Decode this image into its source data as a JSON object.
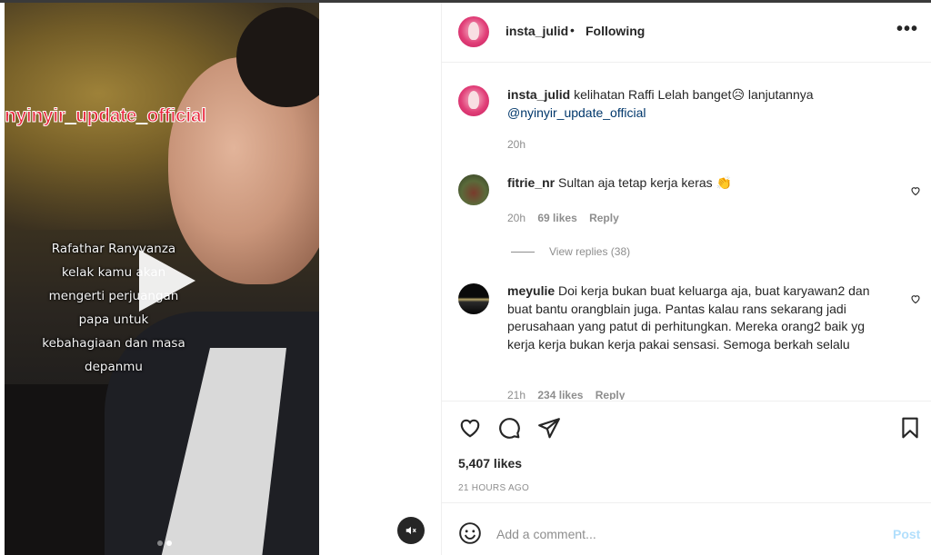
{
  "media": {
    "overlay_tag": "nyinyir_update_official",
    "caption_lines": [
      "Rafathar Ranyvanza",
      "kelak kamu akan",
      "mengerti perjuangan",
      "papa untuk",
      "kebahagiaan dan masa",
      "depanmu"
    ]
  },
  "header": {
    "username": "insta_julid",
    "separator": "•",
    "follow_status": "Following",
    "more": "•••"
  },
  "caption": {
    "username": "insta_julid",
    "text": "kelihatan Raffi Lelah banget😥 lanjutannya",
    "mention": "@nyinyir_update_official",
    "time": "20h"
  },
  "comments": [
    {
      "username": "fitrie_nr",
      "text": "Sultan aja tetap kerja keras 👏",
      "time": "20h",
      "likes": "69 likes",
      "reply": "Reply",
      "view_replies": "View replies (38)"
    },
    {
      "username": "meyulie",
      "text": "Doi kerja bukan buat keluarga aja, buat karyawan2 dan buat bantu orangblain juga. Pantas kalau rans sekarang jadi perusahaan yang patut di perhitungkan. Mereka orang2 baik yg kerja kerja bukan kerja pakai sensasi. Semoga berkah selalu",
      "time": "21h",
      "likes": "234 likes",
      "reply": "Reply"
    }
  ],
  "actions": {
    "likes": "5,407 likes",
    "time_ago": "21 HOURS AGO"
  },
  "add_comment": {
    "placeholder": "Add a comment...",
    "post_label": "Post"
  },
  "colors": {
    "post_disabled": "#b2dffc",
    "muted_text": "#8e8e8e",
    "overlay_tag": "#e8243a"
  }
}
